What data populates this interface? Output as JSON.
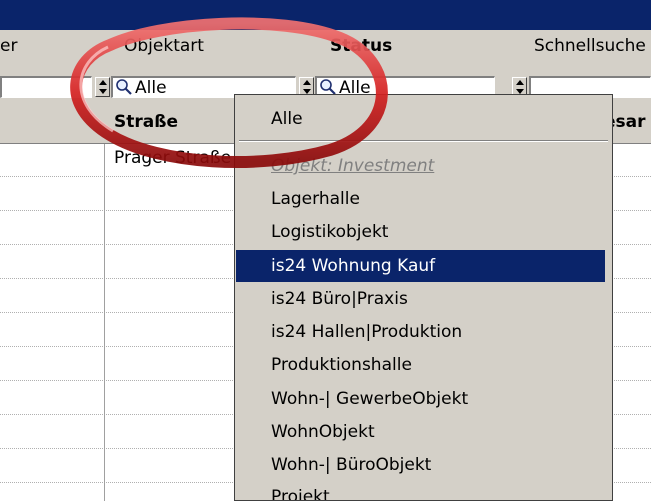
{
  "filter_labels": {
    "partial_left": "er",
    "objektart": "Objektart",
    "status_partial": "Status",
    "schnellsuche": "Schnellsuche"
  },
  "filter_values": {
    "objektart": "Alle",
    "status": "Alle"
  },
  "grid": {
    "header_partial": "Straße",
    "header_right_partial": "esar",
    "first_row_street": "Prager Straße"
  },
  "dropdown": {
    "items": [
      {
        "label": "Alle",
        "kind": "option"
      },
      {
        "label": "Objekt: Investment",
        "kind": "group"
      },
      {
        "label": "Lagerhalle",
        "kind": "option"
      },
      {
        "label": "Logistikobjekt",
        "kind": "option"
      },
      {
        "label": "is24 Wohnung Kauf",
        "kind": "selected"
      },
      {
        "label": "is24 Büro|Praxis",
        "kind": "option"
      },
      {
        "label": "is24 Hallen|Produktion",
        "kind": "option"
      },
      {
        "label": "Produktionshalle",
        "kind": "option"
      },
      {
        "label": "Wohn-| GewerbeObjekt",
        "kind": "option"
      },
      {
        "label": "WohnObjekt",
        "kind": "option"
      },
      {
        "label": "Wohn-| BüroObjekt",
        "kind": "option"
      },
      {
        "label": "Projekt",
        "kind": "option"
      }
    ]
  },
  "colors": {
    "titlebar": "#0a246a",
    "selection": "#0a246a",
    "face": "#d4d0c8",
    "highlight_ring": "#d42020"
  }
}
